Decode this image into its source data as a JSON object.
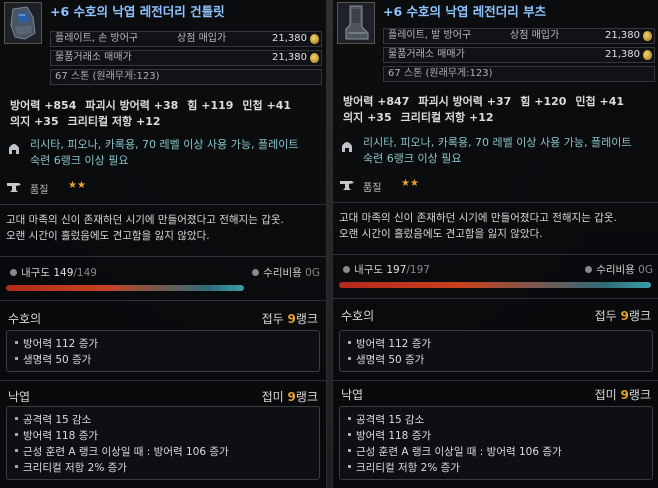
{
  "tooltips": [
    {
      "id": "gloves",
      "icon": "gauntlet-icon",
      "title": "+6 수호의 낙엽 레전더리 건틀릿",
      "type_label": "플레이트, 손 방어구",
      "shop_price_label": "상점 매입가",
      "shop_price": "21,380",
      "market_label": "물품거래소 매매가",
      "market_price": "21,380",
      "weight": "67 스톤 (원래무게:123)",
      "stats_line1": [
        "방어력 +854",
        "파괴시 방어력 +38",
        "힘 +119",
        "민첩 +41"
      ],
      "stats_line2": [
        "의지 +35",
        "크리티컬 저항 +12"
      ],
      "class_line1": "리시타, 피오나, 카록용, 70 레벨 이상 사용 가능, 플레이트",
      "class_line2": "숙련 6랭크 이상 필요",
      "grade_label": "품질",
      "grade_stars": "★★",
      "desc_line1": "고대 마족의 신이 존재하던 시기에 만들어졌다고 전해지는 갑옷.",
      "desc_line2": "오랜 시간이 흘렀음에도 견고함을 잃지 않았다.",
      "durability_label": "내구도",
      "durability_cur": "149",
      "durability_max": "/149",
      "repair_label": "수리비용",
      "repair_cost": "0G",
      "enchant1_title": "수호의",
      "enchant1_rank_prefix": "접두",
      "enchant1_rank_num": "9",
      "enchant1_rank_suffix": "랭크",
      "enchant1_effects": [
        "방어력 112 증가",
        "생명력 50 증가"
      ],
      "enchant2_title": "낙엽",
      "enchant2_rank_prefix": "접미",
      "enchant2_rank_num": "9",
      "enchant2_rank_suffix": "랭크",
      "enchant2_effects": [
        "공격력 15 감소",
        "방어력 118 증가",
        "근성 훈련 A 랭크 이상일 때 : 방어력 106 증가",
        "크리티컬 저항 2% 증가"
      ]
    },
    {
      "id": "boots",
      "icon": "boots-icon",
      "title": "+6 수호의 낙엽 레전더리 부츠",
      "type_label": "플레이트, 발 방어구",
      "shop_price_label": "상점 매입가",
      "shop_price": "21,380",
      "market_label": "물품거래소 매매가",
      "market_price": "21,380",
      "weight": "67 스톤 (원래무게:123)",
      "stats_line1": [
        "방어력 +847",
        "파괴시 방어력 +37",
        "힘 +120",
        "민첩 +41"
      ],
      "stats_line2": [
        "의지 +35",
        "크리티컬 저항 +12"
      ],
      "class_line1": "리시타, 피오나, 카록용, 70 레벨 이상 사용 가능, 플레이트",
      "class_line2": "숙련 6랭크 이상 필요",
      "grade_label": "품질",
      "grade_stars": "★★",
      "desc_line1": "고대 마족의 신이 존재하던 시기에 만들어졌다고 전해지는 갑옷.",
      "desc_line2": "오랜 시간이 흘렀음에도 견고함을 잃지 않았다.",
      "durability_label": "내구도",
      "durability_cur": "197",
      "durability_max": "/197",
      "repair_label": "수리비용",
      "repair_cost": "0G",
      "enchant1_title": "수호의",
      "enchant1_rank_prefix": "접두",
      "enchant1_rank_num": "9",
      "enchant1_rank_suffix": "랭크",
      "enchant1_effects": [
        "방어력 112 증가",
        "생명력 50 증가"
      ],
      "enchant2_title": "낙엽",
      "enchant2_rank_prefix": "접미",
      "enchant2_rank_num": "9",
      "enchant2_rank_suffix": "랭크",
      "enchant2_effects": [
        "공격력 15 감소",
        "방어력 118 증가",
        "근성 훈련 A 랭크 이상일 때 : 방어력 106 증가",
        "크리티컬 저항 2% 증가"
      ]
    }
  ],
  "colors": {
    "title": "#8fc3ff",
    "class_text": "#89c4c9",
    "rank_number": "#e3a12c",
    "stars": "#e1a52d"
  }
}
